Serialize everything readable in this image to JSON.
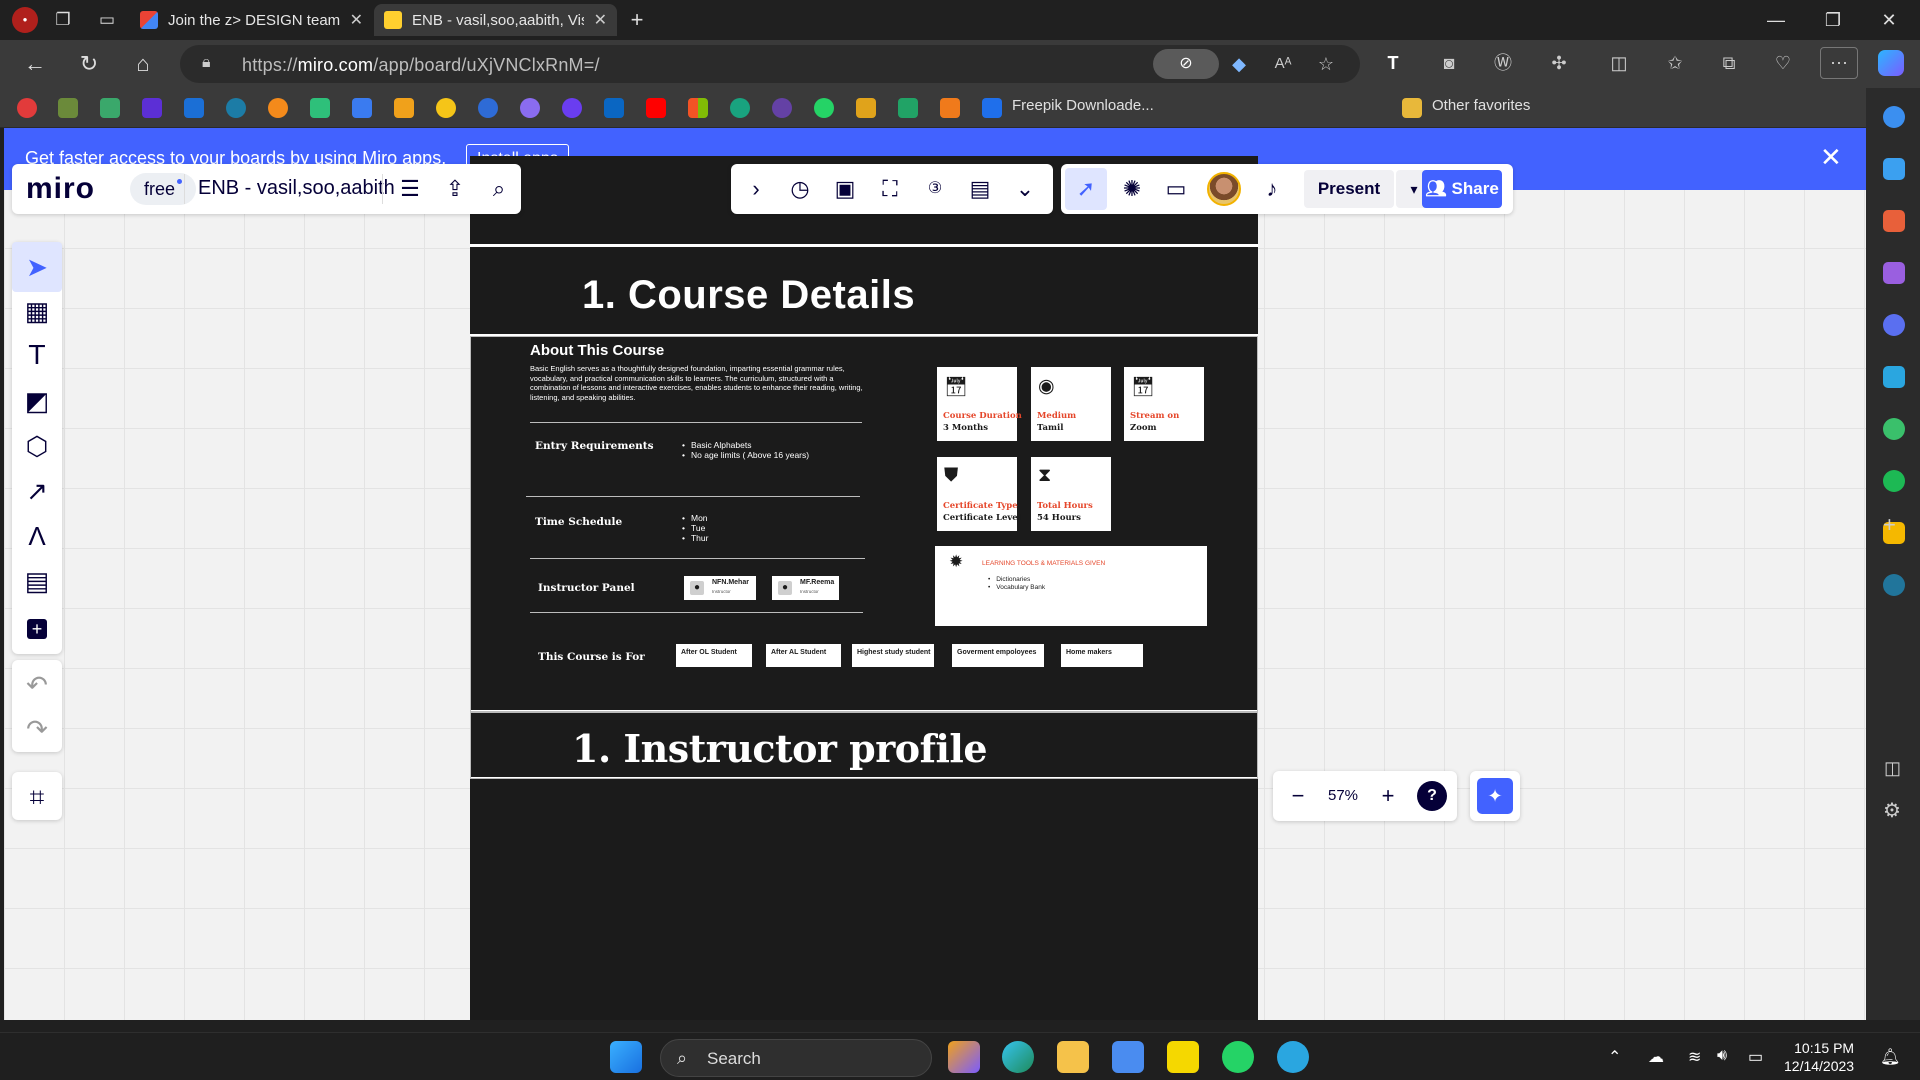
{
  "browser": {
    "tabs": [
      {
        "title": "Join the z> DESIGN team in Miro",
        "active": false
      },
      {
        "title": "ENB - vasil,soo,aabith, Visual Wo",
        "active": true
      }
    ],
    "url_prefix": "https://",
    "url_host": "miro.com",
    "url_path": "/app/board/uXjVNClxRnM=/",
    "favorites_label": "Freepik Downloade...",
    "other_favorites": "Other favorites"
  },
  "banner": {
    "text": "Get faster access to your boards by using Miro apps.",
    "button": "Install apps"
  },
  "miro": {
    "logo": "miro",
    "plan": "free",
    "board_name": "ENB - vasil,soo,aabith",
    "present_label": "Present",
    "share_label": "Share",
    "zoom": "57%"
  },
  "board": {
    "course_heading": "1. Course Details",
    "instructor_heading": "1. Instructor profile",
    "about_title": "About This Course",
    "about_text": "Basic English serves as a thoughtfully designed foundation, imparting essential grammar rules, vocabulary, and practical communication skills to learners. The curriculum, structured with a combination of lessons and interactive exercises, enables students to enhance their reading, writing, listening, and speaking abilities.",
    "entry_label": "Entry Requirements",
    "entry_items": [
      "Basic Alphabets",
      "No age limits ( Above 16 years)"
    ],
    "time_label": "Time Schedule",
    "time_items": [
      "Mon",
      "Tue",
      "Thur"
    ],
    "instructor_label": "Instructor Panel",
    "instructors": [
      {
        "name": "NFN.Mehar",
        "role": "Instructor"
      },
      {
        "name": "MF.Reema",
        "role": "Instructor"
      }
    ],
    "for_label": "This Course is For",
    "audiences": [
      "After OL Student",
      "After AL Student",
      "Highest study student",
      "Goverment empoloyees",
      "Home makers"
    ],
    "cards": [
      {
        "key": "Course Duration",
        "value": "3 Months",
        "icon": "calendar-check-icon"
      },
      {
        "key": "Medium",
        "value": "Tamil",
        "icon": "globe-icon"
      },
      {
        "key": "Stream on",
        "value": "Zoom",
        "icon": "calendar-check-icon"
      },
      {
        "key": "Certificate Type",
        "value": "Certificate Level",
        "icon": "stamp-icon"
      },
      {
        "key": "Total Hours",
        "value": "54 Hours",
        "icon": "hourglass-icon"
      }
    ],
    "tools_title": "LEARNING TOOLS & MATERIALS GIVEN",
    "tools_items": [
      "Dictionaries",
      "Vocabulary Bank"
    ]
  },
  "taskbar": {
    "search": "Search",
    "time": "10:15 PM",
    "date": "12/14/2023"
  }
}
